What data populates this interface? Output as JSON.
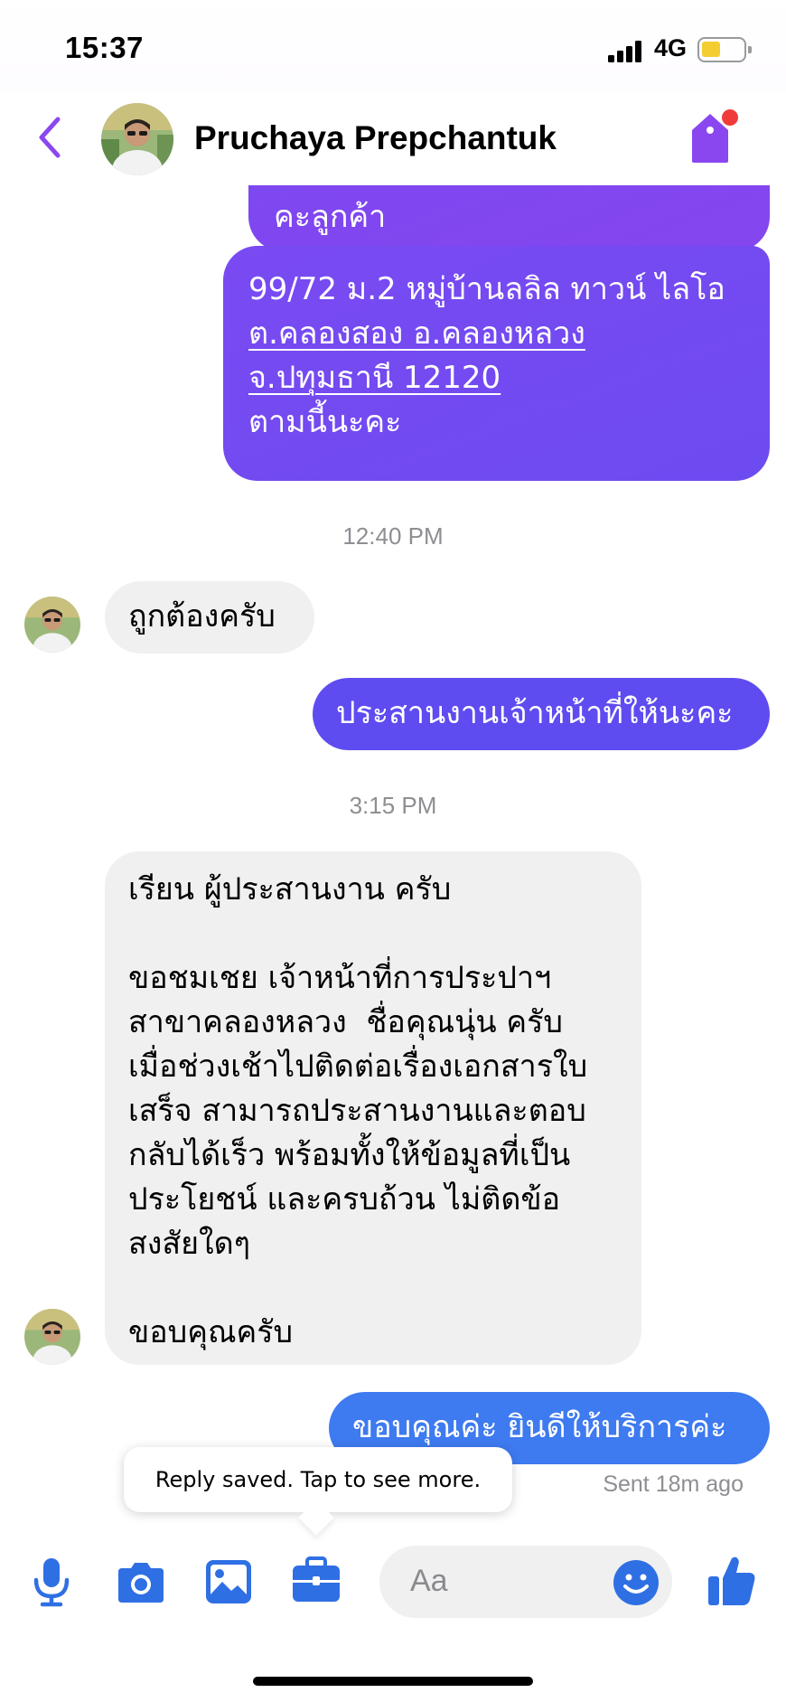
{
  "status_bar": {
    "time": "15:37",
    "network": "4G",
    "battery_level": 0.45,
    "signal_bars": 4
  },
  "header": {
    "contact_name": "Pruchaya Prepchantuk",
    "back_icon": "chevron-left-icon",
    "tag_icon": "tag-icon"
  },
  "colors": {
    "accent": "#8a47f0",
    "bubble_purple": "#7b45f2",
    "bubble_blue": "#3e7af0",
    "incoming_bubble": "#f0f0f0",
    "notification_dot": "#f03b3b",
    "toolbar_blue": "#2f6fe4"
  },
  "messages": {
    "m1_partial": "คะลูกค้า",
    "m2": {
      "line1": "99/72 ม.2 หมู่บ้านลลิล ทาวน์ ไลโอ",
      "line2": "ต.คลองสอง อ.คลองหลวง",
      "line3": "จ.ปทุมธานี 12120",
      "line4": "ตามนี้นะคะ"
    },
    "ts1": "12:40 PM",
    "m3": "ถูกต้องครับ",
    "m4": "ประสานงานเจ้าหน้าที่ให้นะคะ",
    "ts2": "3:15 PM",
    "m5": "เรียน ผู้ประสานงาน ครับ\n\nขอชมเชย เจ้าหน้าที่การประปาฯ\nสาขาคลองหลวง  ชื่อคุณนุ่น ครับ\nเมื่อช่วงเช้าไปติดต่อเรื่องเอกสารใบ\nเสร็จ สามารถประสานงานและตอบ\nกลับได้เร็ว พร้อมทั้งให้ข้อมูลที่เป็น\nประโยชน์ และครบถ้วน ไม่ติดข้อ\nสงสัยใดๆ\n\nขอบคุณครับ",
    "m6": "ขอบคุณค่ะ ยินดีให้บริการค่ะ"
  },
  "sent_status": "Sent 18m ago",
  "tooltip": "Reply saved. Tap to see more.",
  "composer": {
    "placeholder": "Aa",
    "icons": [
      "microphone-icon",
      "camera-icon",
      "image-icon",
      "briefcase-icon",
      "emoji-icon",
      "thumbs-up-icon"
    ]
  }
}
